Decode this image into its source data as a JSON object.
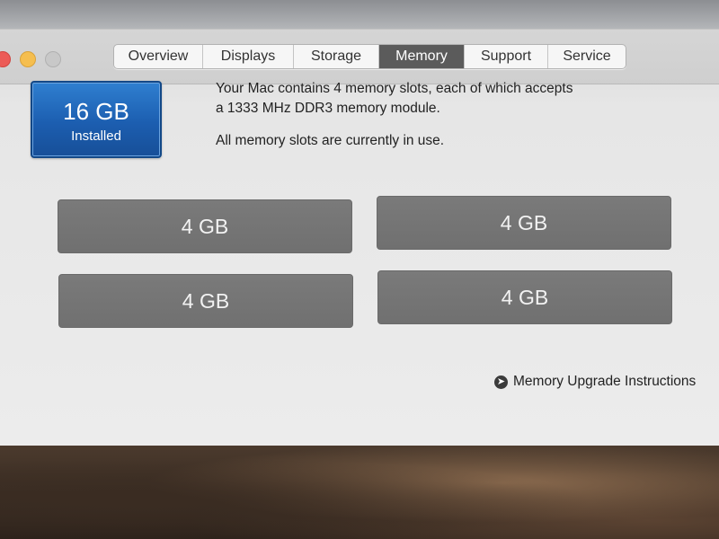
{
  "window": {
    "tabs": [
      {
        "label": "Overview",
        "active": false
      },
      {
        "label": "Displays",
        "active": false
      },
      {
        "label": "Storage",
        "active": false
      },
      {
        "label": "Memory",
        "active": true
      },
      {
        "label": "Support",
        "active": false
      },
      {
        "label": "Service",
        "active": false
      }
    ]
  },
  "memory": {
    "installed_size": "16 GB",
    "installed_label": "Installed",
    "description_line1": "Your Mac contains 4 memory slots, each of which accepts",
    "description_line2": "a 1333 MHz DDR3 memory module.",
    "status": "All memory slots are currently in use.",
    "slots": [
      {
        "size": "4 GB"
      },
      {
        "size": "4 GB"
      },
      {
        "size": "4 GB"
      },
      {
        "size": "4 GB"
      }
    ],
    "upgrade_link": "Memory Upgrade Instructions",
    "upgrade_icon": "arrow-right-circle-icon"
  },
  "colors": {
    "badge_blue": "#1c5eb0",
    "slot_gray": "#757575",
    "active_tab": "#5b5b5b"
  }
}
